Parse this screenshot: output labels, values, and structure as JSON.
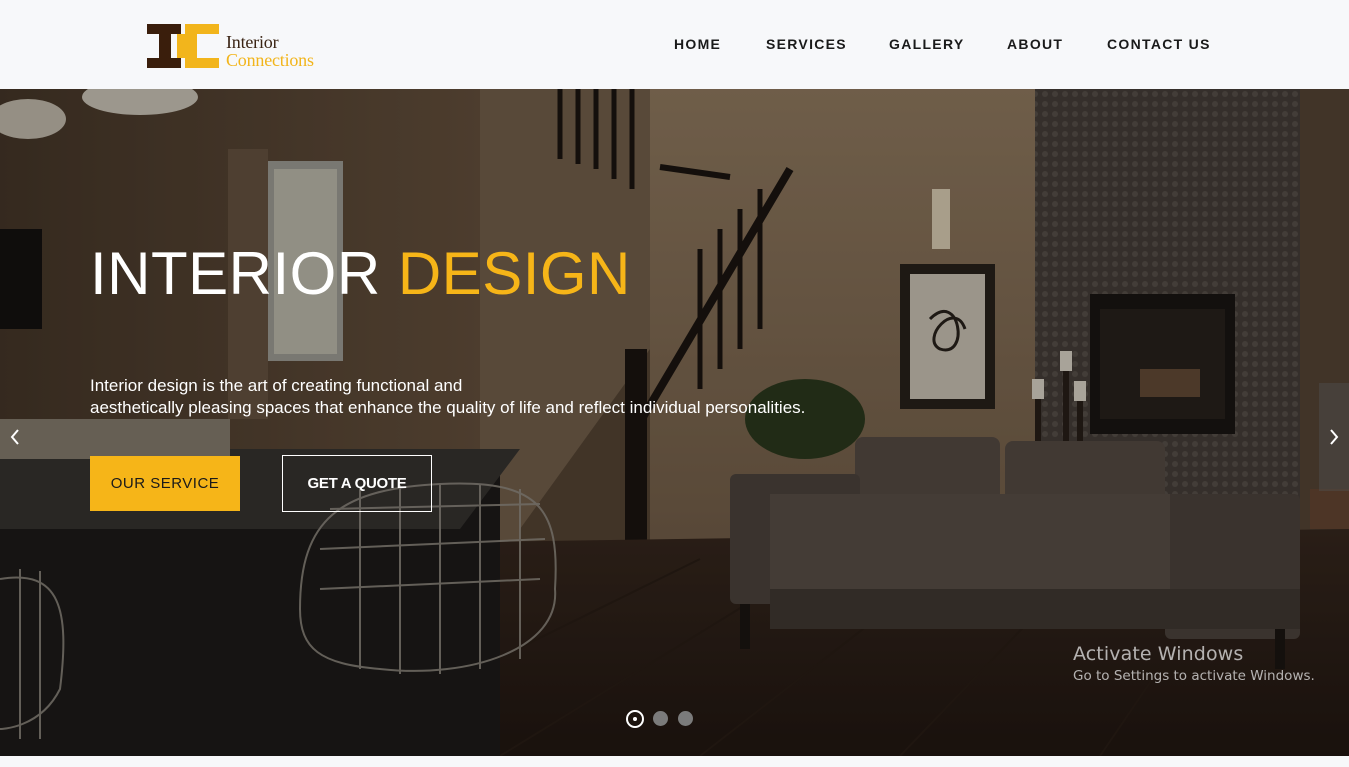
{
  "header": {
    "logo": {
      "line1": "Interior",
      "line2": "Connections",
      "colors": {
        "dark": "#3a1e0c",
        "gold": "#f2b51c"
      }
    },
    "nav": [
      {
        "label": "HOME"
      },
      {
        "label": "SERVICES"
      },
      {
        "label": "GALLERY"
      },
      {
        "label": "ABOUT"
      },
      {
        "label": "CONTACT US"
      }
    ]
  },
  "hero": {
    "title_main": "INTERIOR",
    "title_accent": "DESIGN",
    "description_line1": "Interior design is the art of creating functional and",
    "description_line2": "aesthetically pleasing spaces that enhance the quality of life and reflect individual personalities.",
    "buttons": {
      "primary_label": "OUR SERVICE",
      "secondary_label": "GET A QUOTE"
    },
    "carousel": {
      "prev_icon": "chevron-left-icon",
      "next_icon": "chevron-right-icon",
      "slide_count": 3,
      "active_slide": 1
    },
    "accent_color": "#f6b518"
  },
  "os_watermark": {
    "title": "Activate Windows",
    "subtitle": "Go to Settings to activate Windows."
  }
}
